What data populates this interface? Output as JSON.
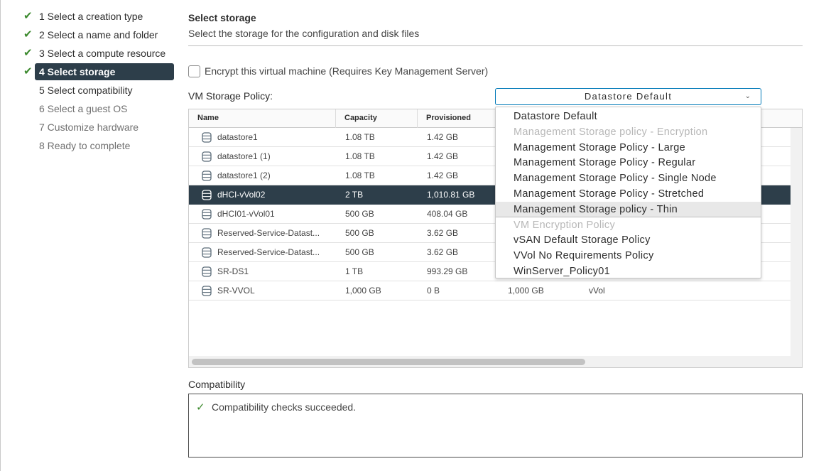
{
  "steps": [
    {
      "label": "1 Select a creation type",
      "state": "done"
    },
    {
      "label": "2 Select a name and folder",
      "state": "done"
    },
    {
      "label": "3 Select a compute resource",
      "state": "done"
    },
    {
      "label": "4 Select storage",
      "state": "active"
    },
    {
      "label": "5 Select compatibility",
      "state": "upcoming"
    },
    {
      "label": "6 Select a guest OS",
      "state": "todo"
    },
    {
      "label": "7 Customize hardware",
      "state": "todo"
    },
    {
      "label": "8 Ready to complete",
      "state": "todo"
    }
  ],
  "check_glyph": "✔",
  "page": {
    "heading": "Select storage",
    "subheading": "Select the storage for the configuration and disk files"
  },
  "encrypt": {
    "label": "Encrypt this virtual machine (Requires Key Management Server)",
    "checked": false
  },
  "policy": {
    "label": "VM Storage Policy:",
    "selected": "Datastore Default",
    "options": [
      {
        "label": "Datastore Default",
        "disabled": false
      },
      {
        "label": "Management Storage policy - Encryption",
        "disabled": true
      },
      {
        "label": "Management Storage Policy - Large",
        "disabled": false
      },
      {
        "label": "Management Storage Policy - Regular",
        "disabled": false
      },
      {
        "label": "Management Storage Policy - Single Node",
        "disabled": false
      },
      {
        "label": "Management Storage Policy - Stretched",
        "disabled": false
      },
      {
        "label": "Management Storage policy - Thin",
        "disabled": false,
        "hover": true
      },
      {
        "label": "VM Encryption Policy",
        "disabled": true
      },
      {
        "label": "vSAN Default Storage Policy",
        "disabled": false
      },
      {
        "label": "VVol No Requirements Policy",
        "disabled": false
      },
      {
        "label": "WinServer_Policy01",
        "disabled": false
      }
    ]
  },
  "table": {
    "columns": [
      "Name",
      "Capacity",
      "Provisioned"
    ],
    "rows": [
      {
        "name": "datastore1",
        "capacity": "1.08 TB",
        "provisioned": "1.42 GB",
        "free": "",
        "type": ""
      },
      {
        "name": "datastore1 (1)",
        "capacity": "1.08 TB",
        "provisioned": "1.42 GB",
        "free": "",
        "type": ""
      },
      {
        "name": "datastore1 (2)",
        "capacity": "1.08 TB",
        "provisioned": "1.42 GB",
        "free": "",
        "type": ""
      },
      {
        "name": "dHCI-vVol02",
        "capacity": "2 TB",
        "provisioned": "1,010.81 GB",
        "free": "",
        "type": "",
        "selected": true
      },
      {
        "name": "dHCI01-vVol01",
        "capacity": "500 GB",
        "provisioned": "408.04 GB",
        "free": "",
        "type": ""
      },
      {
        "name": "Reserved-Service-Datast...",
        "capacity": "500 GB",
        "provisioned": "3.62 GB",
        "free": "",
        "type": ""
      },
      {
        "name": "Reserved-Service-Datast...",
        "capacity": "500 GB",
        "provisioned": "3.62 GB",
        "free": "",
        "type": ""
      },
      {
        "name": "SR-DS1",
        "capacity": "1 TB",
        "provisioned": "993.29 GB",
        "free": "",
        "type": ""
      },
      {
        "name": "SR-VVOL",
        "capacity": "1,000 GB",
        "provisioned": "0 B",
        "free": "1,000 GB",
        "type": "vVol"
      }
    ]
  },
  "compatibility": {
    "label": "Compatibility",
    "message": "Compatibility checks succeeded.",
    "check_glyph": "✓"
  },
  "colors": {
    "accent": "#0079b8",
    "selected_row": "#2d3e4a",
    "success": "#3c8a2e"
  }
}
